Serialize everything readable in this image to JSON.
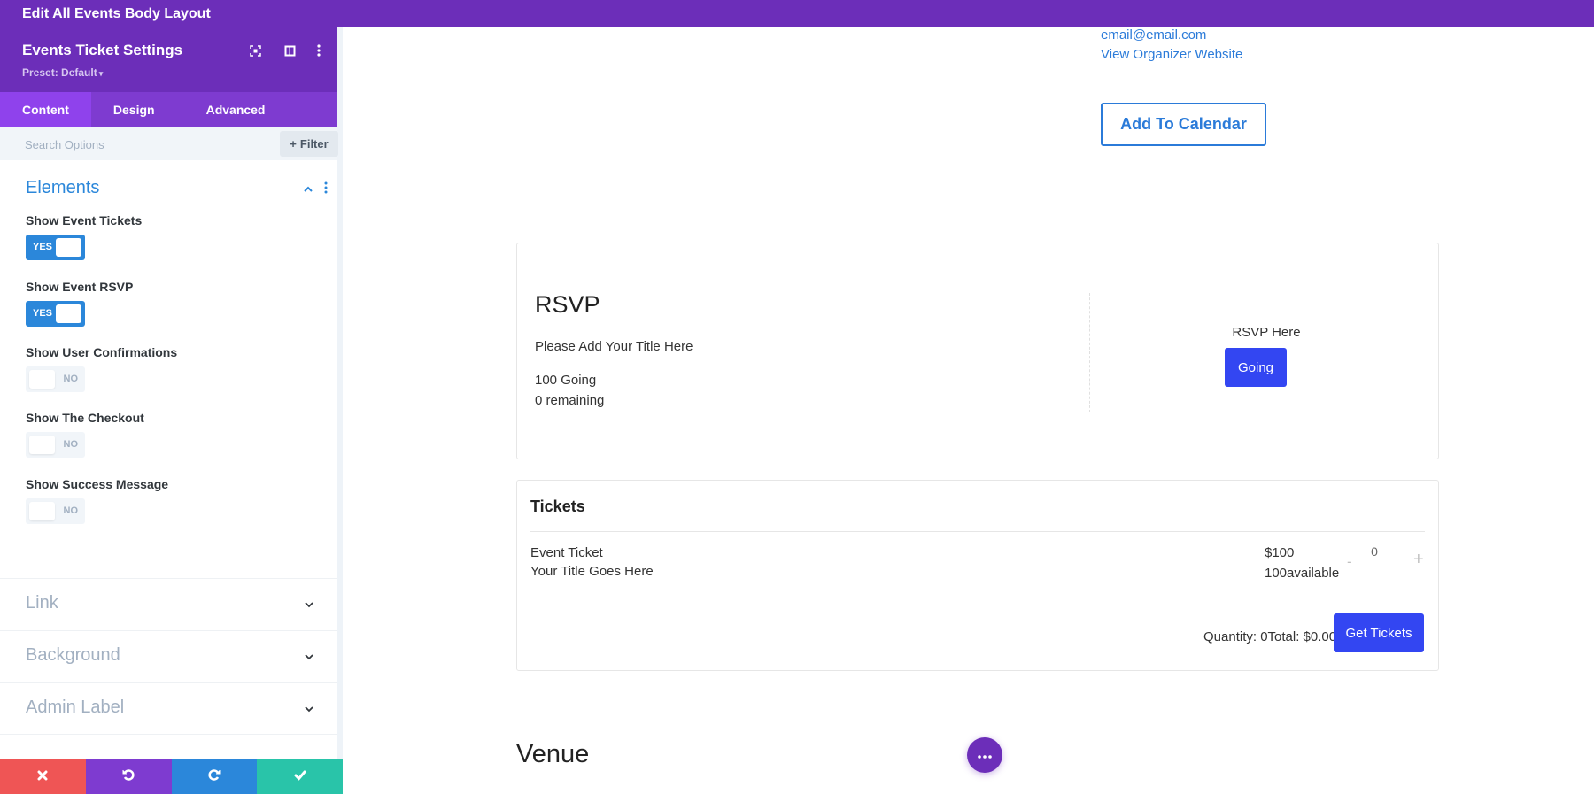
{
  "topbar": {
    "title": "Edit All Events Body Layout"
  },
  "sidebar": {
    "title": "Events Ticket Settings",
    "preset": "Preset: Default",
    "header_icons": [
      "focus-mode-icon",
      "split-view-icon",
      "more-vertical-icon"
    ],
    "tabs": [
      {
        "label": "Content",
        "active": true
      },
      {
        "label": "Design",
        "active": false
      },
      {
        "label": "Advanced",
        "active": false
      }
    ],
    "search": {
      "placeholder": "Search Options",
      "value": ""
    },
    "filter_label": "Filter",
    "elements_section": {
      "title": "Elements",
      "options": [
        {
          "label": "Show Event Tickets",
          "value": "YES",
          "on": true
        },
        {
          "label": "Show Event RSVP",
          "value": "YES",
          "on": true
        },
        {
          "label": "Show User Confirmations",
          "value": "NO",
          "on": false
        },
        {
          "label": "Show The Checkout",
          "value": "NO",
          "on": false
        },
        {
          "label": "Show Success Message",
          "value": "NO",
          "on": false
        }
      ]
    },
    "collapsed_sections": [
      {
        "title": "Link"
      },
      {
        "title": "Background"
      },
      {
        "title": "Admin Label"
      }
    ],
    "footer": {
      "buttons": [
        "cancel",
        "undo",
        "redo",
        "save"
      ],
      "colors": {
        "cancel": "#ef5555",
        "undo": "#7e3bd0",
        "redo": "#2b87da",
        "save": "#29c4a9"
      }
    }
  },
  "canvas": {
    "organizer": {
      "email": "email@email.com",
      "website_link": "View Organizer Website"
    },
    "add_to_calendar": "Add To Calendar",
    "rsvp": {
      "title": "RSVP",
      "subtitle": "Please Add Your Title Here",
      "going_count": "100 Going",
      "remaining": "0 remaining",
      "prompt": "RSVP Here",
      "button": "Going"
    },
    "tickets": {
      "title": "Tickets",
      "items": [
        {
          "name": "Event Ticket",
          "description": "Your Title Goes Here",
          "price": "$100",
          "available": "100available",
          "quantity": "0"
        }
      ],
      "minus": "-",
      "plus": "+",
      "summary": "Quantity: 0Total: $0.00",
      "button": "Get Tickets"
    },
    "venue_heading": "Venue"
  },
  "colors": {
    "brand_purple": "#6c2eb9",
    "accent_blue": "#2b87da",
    "button_blue": "#3346f2",
    "link_blue": "#2b7bd9"
  }
}
